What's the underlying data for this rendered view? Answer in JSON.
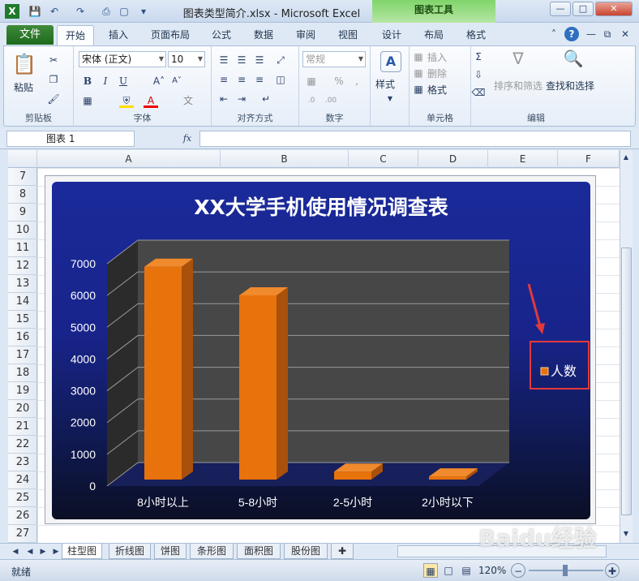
{
  "app": {
    "title": "图表类型简介.xlsx  -  Microsoft Excel",
    "context_tab_group": "图表工具"
  },
  "tabs": [
    {
      "label": "文件"
    },
    {
      "label": "开始"
    },
    {
      "label": "插入"
    },
    {
      "label": "页面布局"
    },
    {
      "label": "公式"
    },
    {
      "label": "数据"
    },
    {
      "label": "审阅"
    },
    {
      "label": "视图"
    },
    {
      "label": "设计"
    },
    {
      "label": "布局"
    },
    {
      "label": "格式"
    }
  ],
  "ribbon": {
    "clipboard": {
      "paste": "粘贴",
      "label": "剪贴板"
    },
    "font": {
      "name": "宋体 (正文)",
      "size": "10",
      "label": "字体"
    },
    "alignment": {
      "label": "对齐方式"
    },
    "number": {
      "format": "常规",
      "label": "数字"
    },
    "styles": {
      "label": "样式"
    },
    "cells": {
      "insert": "插入",
      "delete": "删除",
      "format": "格式",
      "label": "单元格"
    },
    "editing": {
      "sort_filter": "排序和筛选",
      "find_select": "查找和选择",
      "label": "编辑"
    }
  },
  "formula_bar": {
    "name_box": "图表 1",
    "fx": "fx",
    "value": ""
  },
  "columns": [
    "A",
    "B",
    "C",
    "D",
    "E",
    "F"
  ],
  "rows": [
    "7",
    "8",
    "9",
    "10",
    "11",
    "12",
    "13",
    "14",
    "15",
    "16",
    "17",
    "18",
    "19",
    "20",
    "21",
    "22",
    "23",
    "24",
    "25",
    "26",
    "27"
  ],
  "chart_data": {
    "type": "bar",
    "title": "XX大学手机使用情况调查表",
    "categories": [
      "8小时以上",
      "5-8小时",
      "2-5小时",
      "2小时以下"
    ],
    "series": [
      {
        "name": "人数",
        "values": [
          6700,
          5800,
          250,
          100
        ]
      }
    ],
    "ylim": [
      0,
      7000
    ],
    "yticks": [
      "0",
      "1000",
      "2000",
      "3000",
      "4000",
      "5000",
      "6000",
      "7000"
    ],
    "grid": true,
    "legend": "right",
    "bar_color": "#e8720c"
  },
  "sheets": [
    "柱型图",
    "折线图",
    "饼图",
    "条形图",
    "面积图",
    "股份图"
  ],
  "status": {
    "ready": "就绪",
    "zoom": "120%"
  },
  "watermark": "Baidu经验"
}
